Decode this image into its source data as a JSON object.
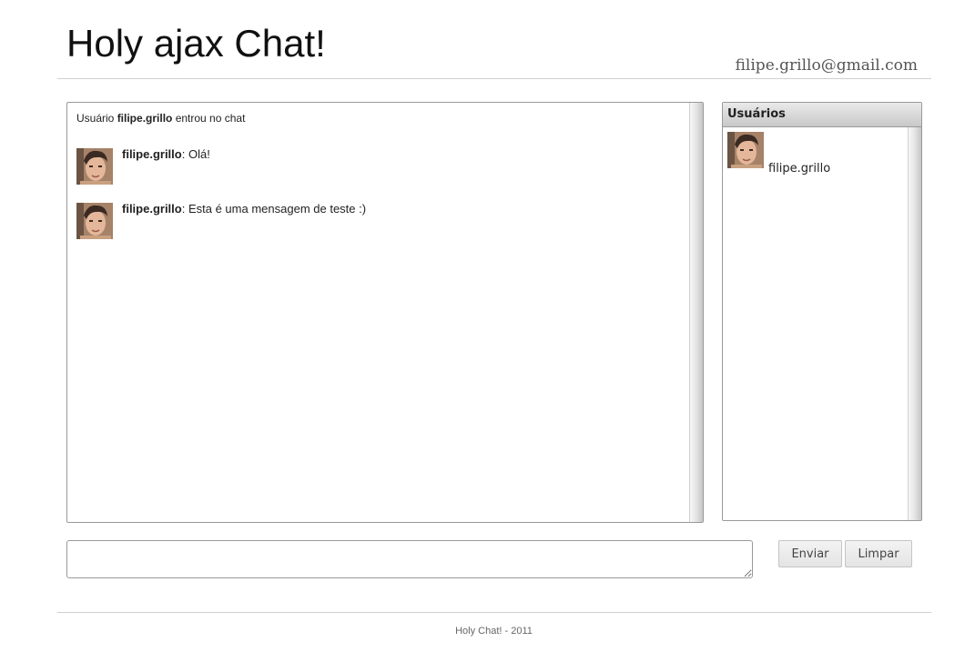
{
  "header": {
    "title": "Holy ajax Chat!",
    "user_email": "filipe.grillo@gmail.com"
  },
  "chat": {
    "system_message": {
      "prefix": "Usuário ",
      "user": "filipe.grillo",
      "suffix": " entrou no chat"
    },
    "messages": [
      {
        "author": "filipe.grillo",
        "separator": ": ",
        "text": "Olá!",
        "avatar": "user-avatar-photo"
      },
      {
        "author": "filipe.grillo",
        "separator": ": ",
        "text": "Esta é uma mensagem de teste :)",
        "avatar": "user-avatar-photo"
      }
    ]
  },
  "users_panel": {
    "title": "Usuários",
    "users": [
      {
        "name": "filipe.grillo",
        "avatar": "user-avatar-photo"
      }
    ]
  },
  "composer": {
    "value": "",
    "send_label": "Enviar",
    "clear_label": "Limpar"
  },
  "footer": {
    "text": "Holy Chat! - 2011"
  },
  "colors": {
    "border": "#9a9a9a",
    "divider": "#cfcfcf",
    "button_bg": "#e9e9e9",
    "header_bg": "#d4d4d4"
  }
}
